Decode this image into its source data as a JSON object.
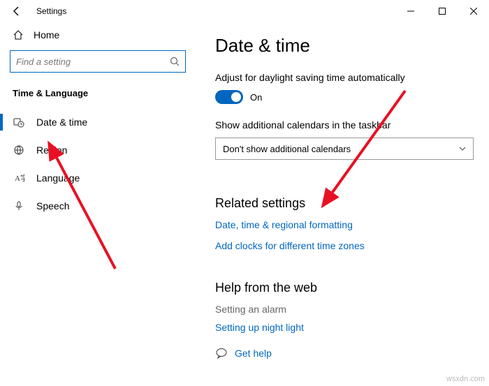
{
  "window": {
    "title": "Settings",
    "controls": {
      "min": "minimize",
      "max": "maximize",
      "close": "close"
    }
  },
  "sidebar": {
    "home": "Home",
    "search_placeholder": "Find a setting",
    "group": "Time & Language",
    "items": [
      {
        "label": "Date & time",
        "icon": "clock-calendar-icon",
        "selected": true
      },
      {
        "label": "Region",
        "icon": "globe-icon",
        "selected": false
      },
      {
        "label": "Language",
        "icon": "a-letter-icon",
        "selected": false
      },
      {
        "label": "Speech",
        "icon": "microphone-icon",
        "selected": false
      }
    ]
  },
  "page": {
    "title": "Date & time",
    "daylight_label": "Adjust for daylight saving time automatically",
    "daylight_state": "On",
    "calendars_label": "Show additional calendars in the taskbar",
    "calendars_value": "Don't show additional calendars",
    "related_heading": "Related settings",
    "related_links": [
      "Date, time & regional formatting",
      "Add clocks for different time zones"
    ],
    "help_heading": "Help from the web",
    "help_muted": "Setting an alarm",
    "help_link": "Setting up night light",
    "get_help": "Get help"
  },
  "watermark": "wsxdn.com"
}
